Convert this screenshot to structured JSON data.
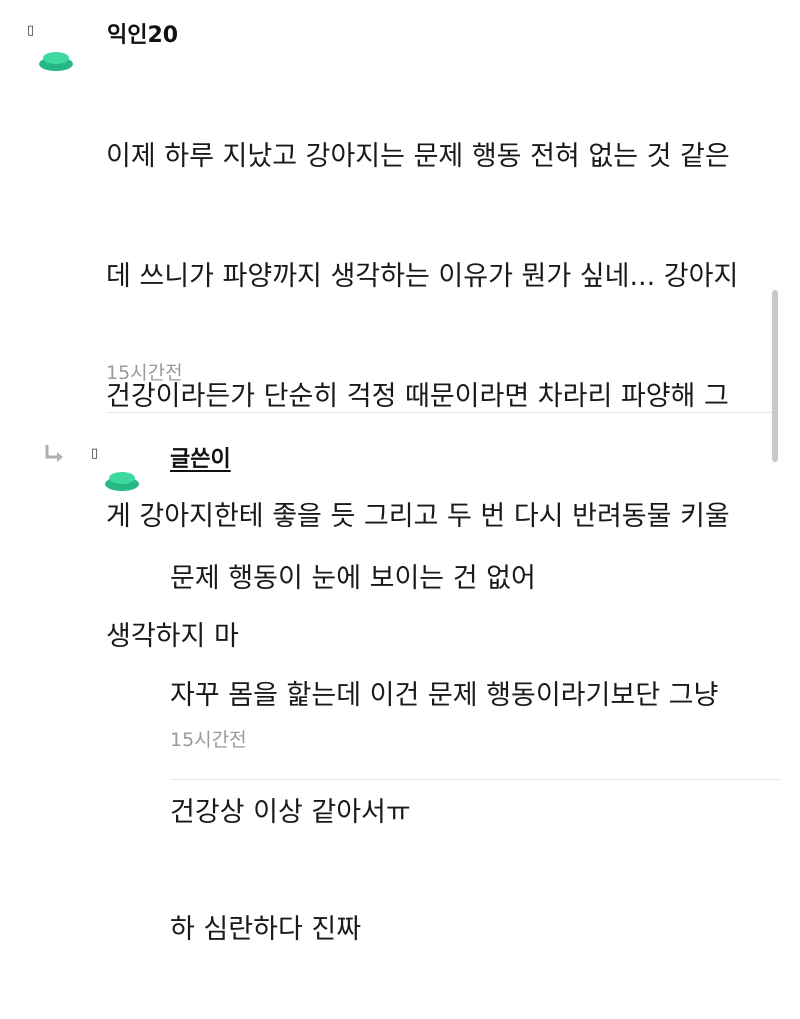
{
  "colors": {
    "avatar_green": "#3dd9a0",
    "avatar_green_dark": "#27b985",
    "time_gray": "#9a9a9a",
    "divider": "#e8e8e8"
  },
  "comment": {
    "avatar_glyph": "▯",
    "nickname": "익인20",
    "lines": [
      "이제 하루 지났고 강아지는 문제 행동 전혀 없는 것 같은",
      "데 쓰니가 파양까지 생각하는 이유가 뭔가 싶네... 강아지",
      "건강이라든가 단순히 걱정 때문이라면 차라리 파양해 그",
      "게 강아지한테 좋을 듯 그리고 두 번 다시 반려동물 키울",
      "생각하지 마"
    ],
    "time": "15시간전"
  },
  "reply": {
    "arrow_icon": "reply-arrow-icon",
    "avatar_glyph": "▯",
    "nickname": "글쓴이",
    "lines": [
      "문제 행동이 눈에 보이는 건 없어",
      "자꾸 몸을 핥는데 이건 문제 행동이라기보단 그냥",
      "건강상 이상 같아서ㅠ",
      "하 심란하다 진짜"
    ],
    "time": "15시간전"
  }
}
